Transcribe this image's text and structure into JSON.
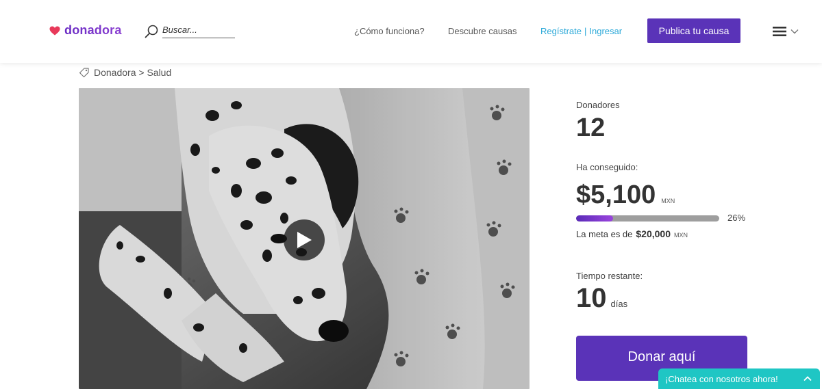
{
  "header": {
    "brand": "donadora",
    "search_placeholder": "Buscar...",
    "nav": {
      "how_it_works": "¿Cómo funciona?",
      "discover": "Descubre causas",
      "register": "Regístrate",
      "separator": "|",
      "login": "Ingresar"
    },
    "publish_button": "Publica tu causa",
    "icons": {
      "logo": "heart-icon",
      "search": "search-icon",
      "menu": "hamburger-menu-icon",
      "menu_caret": "chevron-down-icon"
    }
  },
  "breadcrumb": {
    "icon": "tag-icon",
    "text": "Donadora > Salud"
  },
  "media": {
    "play_icon": "play-icon"
  },
  "stats": {
    "donors_label": "Donadores",
    "donors_value": "12",
    "raised_label": "Ha conseguido:",
    "raised_value": "$5,100",
    "currency": "MXN",
    "progress_percent": 26,
    "progress_label": "26%",
    "goal_prefix": "La meta es de",
    "goal_value": "$20,000",
    "goal_currency": "MXN",
    "time_label": "Tiempo restante:",
    "time_value": "10",
    "time_unit": "días",
    "donate_button": "Donar aquí"
  },
  "chat": {
    "label": "¡Chatea con nosotros ahora!",
    "icon": "chevron-up-icon"
  },
  "colors": {
    "brand_purple": "#5a33b8",
    "link_blue": "#2aa8d8",
    "chat_teal": "#1fc6c4",
    "heart_pink": "#e8395a"
  }
}
